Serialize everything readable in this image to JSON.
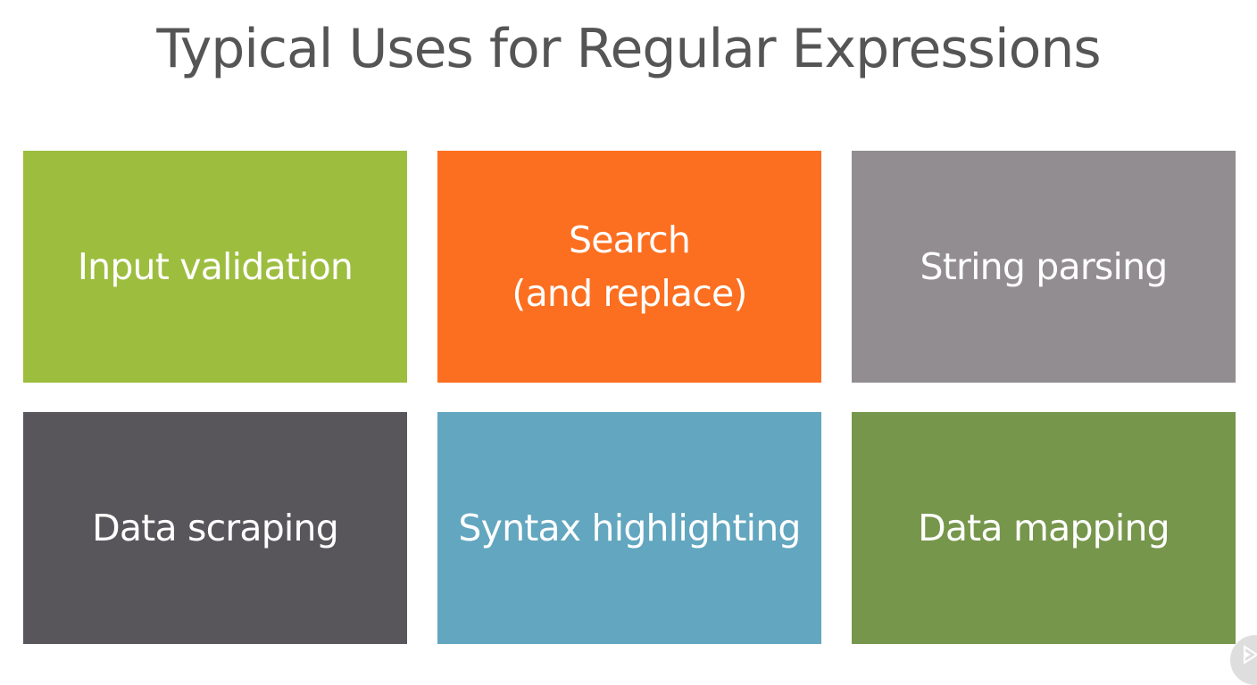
{
  "title": "Typical Uses for Regular Expressions",
  "tiles": [
    {
      "lines": [
        "Input validation"
      ],
      "color": "#9dbd3f"
    },
    {
      "lines": [
        "Search",
        "(and replace)"
      ],
      "color": "#fc6f20"
    },
    {
      "lines": [
        "String parsing"
      ],
      "color": "#928d90"
    },
    {
      "lines": [
        "Data scraping"
      ],
      "color": "#58565b"
    },
    {
      "lines": [
        "Syntax highlighting"
      ],
      "color": "#62a6bf"
    },
    {
      "lines": [
        "Data mapping"
      ],
      "color": "#76964b"
    }
  ],
  "logo": {
    "icon": "play-logo-icon"
  }
}
